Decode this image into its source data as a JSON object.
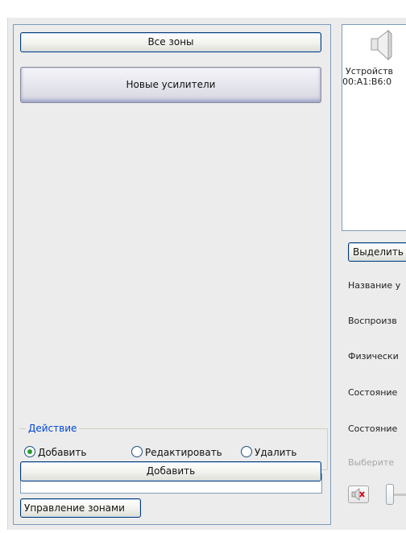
{
  "left": {
    "all_zones_label": "Все зоны",
    "new_amplifiers_label": "Новые усилители",
    "action_group": {
      "title": "Действие",
      "options": [
        "Добавить",
        "Редактировать",
        "Удалить"
      ],
      "selected": "Добавить"
    },
    "name_input_value": "",
    "add_button_label": "Добавить",
    "manage_zones_label": "Управление зонами"
  },
  "right": {
    "device": {
      "icon": "speaker-icon",
      "name_line1": "Устройств",
      "name_line2": "00:A1:B6:0"
    },
    "select_button_label": "Выделить",
    "properties": [
      {
        "label": "Название у"
      },
      {
        "label": "Воспроизв"
      },
      {
        "label": "Физически"
      },
      {
        "label": "Состояние"
      },
      {
        "label": "Состояние"
      }
    ],
    "hint_label": "Выберите",
    "mute_icon": "speaker-mute-icon"
  },
  "colors": {
    "accent_blue": "#0046d5",
    "button_border": "#003c74",
    "panel_bg": "#ececec"
  }
}
